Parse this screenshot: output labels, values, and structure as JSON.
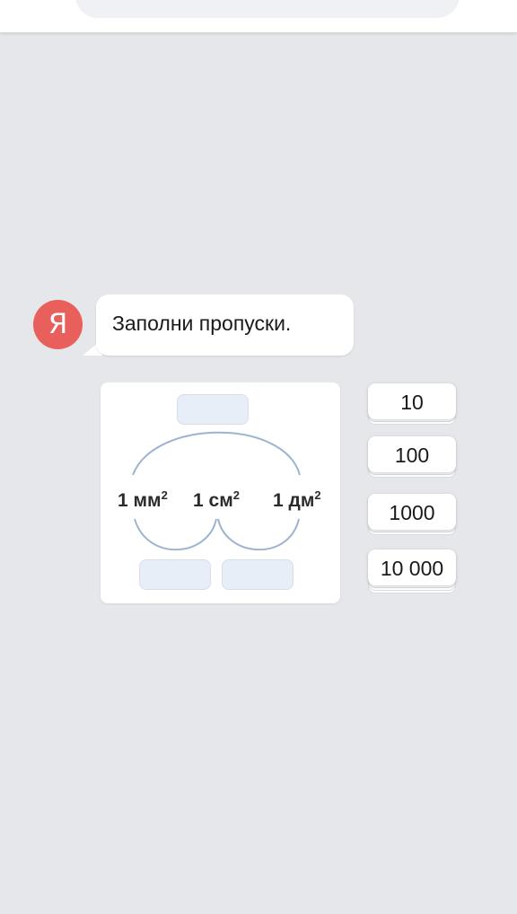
{
  "assistant": {
    "avatar_letter": "Я",
    "message": "Заполни пропуски."
  },
  "task": {
    "units": [
      {
        "value": "1 мм",
        "exponent": "2"
      },
      {
        "value": "1 см",
        "exponent": "2"
      },
      {
        "value": "1 дм",
        "exponent": "2"
      }
    ],
    "blank_slots": 3
  },
  "answer_options": [
    "10",
    "100",
    "1000",
    "10 000"
  ],
  "colors": {
    "background": "#e6e7eb",
    "avatar": "#e85f5b",
    "arc": "#9db4d0",
    "slot_fill": "#e8eef8"
  }
}
